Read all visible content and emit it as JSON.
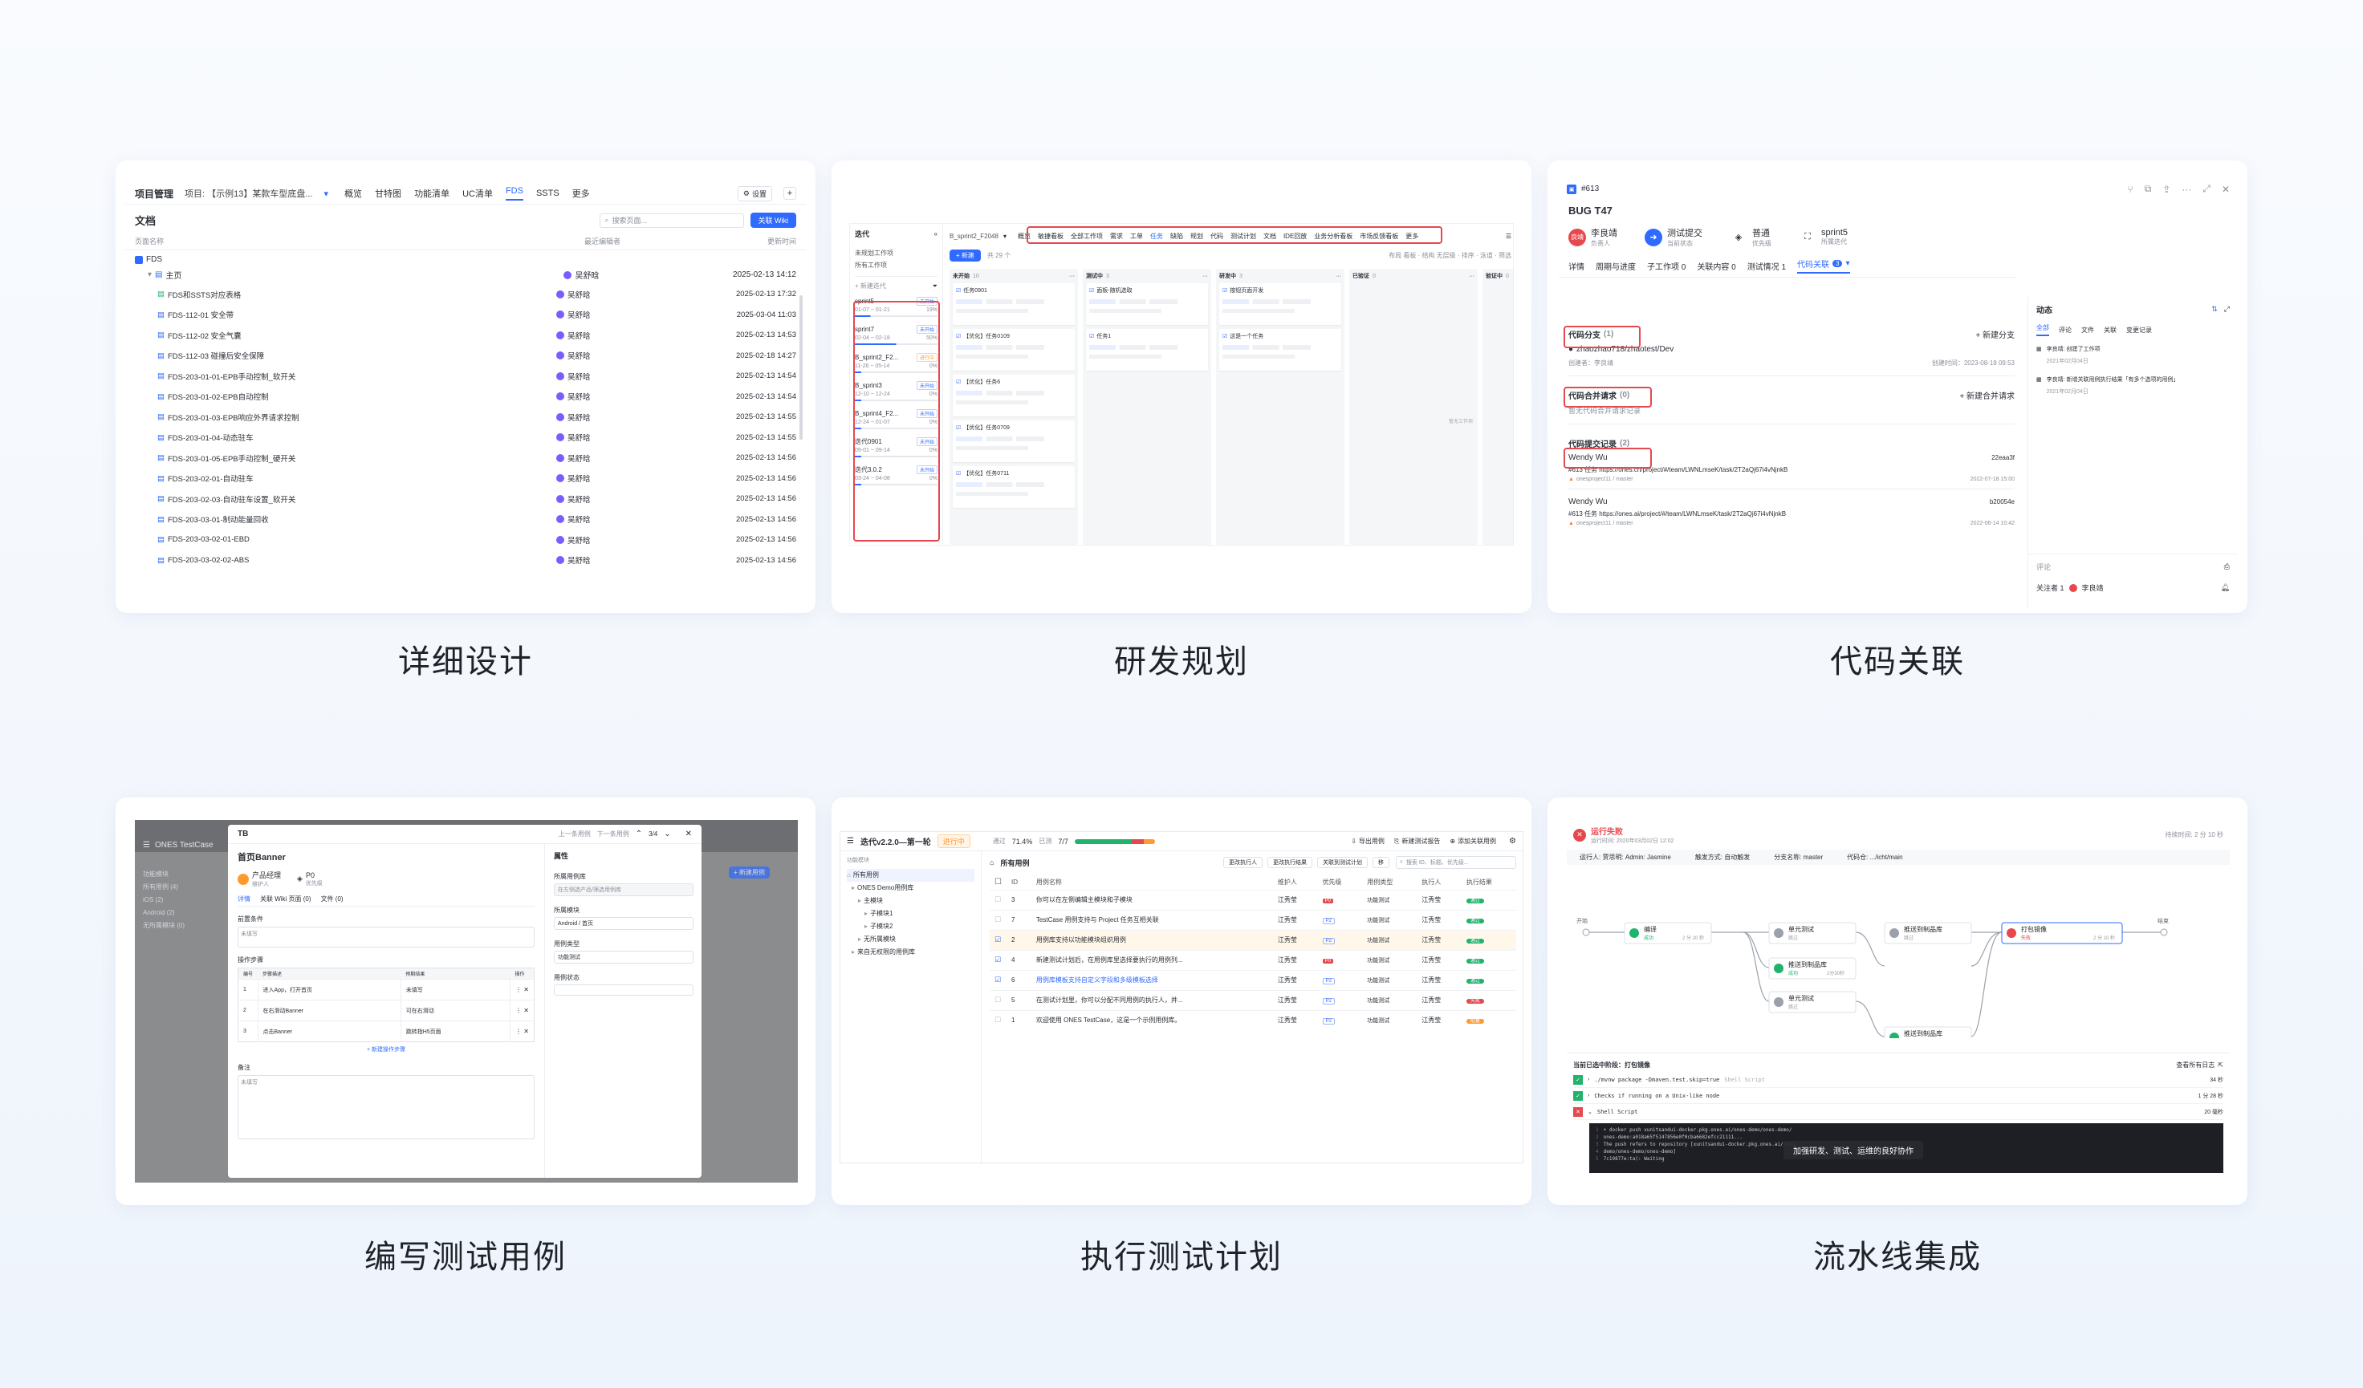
{
  "cards": {
    "c1": {
      "caption": "详细设计"
    },
    "c2": {
      "caption": "研发规划"
    },
    "c3": {
      "caption": "代码关联"
    },
    "c4": {
      "caption": "编写测试用例"
    },
    "c5": {
      "caption": "执行测试计划"
    },
    "c6": {
      "caption": "流水线集成"
    }
  },
  "design": {
    "app": "项目管理",
    "project": "项目: 【示例13】某款车型底盘...",
    "tabs": [
      "概览",
      "甘特图",
      "功能清单",
      "UC清单",
      "FDS",
      "SSTS",
      "更多"
    ],
    "settings": "设置",
    "doc_title": "文档",
    "search_placeholder": "搜索页面...",
    "wiki_btn": "关联 Wiki",
    "col_name": "页面名称",
    "col_editor": "最近编辑者",
    "col_time": "更新时间",
    "root": "FDS",
    "home": "主页",
    "rows": [
      {
        "name": "FDS和SSTS对应表格",
        "editor": "吴舒晗",
        "time": "2025-02-13 17:32"
      },
      {
        "name": "FDS-112-01 安全带",
        "editor": "吴舒晗",
        "time": "2025-03-04 11:03"
      },
      {
        "name": "FDS-112-02 安全气囊",
        "editor": "吴舒晗",
        "time": "2025-02-13 14:53"
      },
      {
        "name": "FDS-112-03 碰撞后安全保障",
        "editor": "吴舒晗",
        "time": "2025-02-18 14:27"
      },
      {
        "name": "FDS-203-01-01-EPB手动控制_软开关",
        "editor": "吴舒晗",
        "time": "2025-02-13 14:54"
      },
      {
        "name": "FDS-203-01-02-EPB自动控制",
        "editor": "吴舒晗",
        "time": "2025-02-13 14:54"
      },
      {
        "name": "FDS-203-01-03-EPB响应外界请求控制",
        "editor": "吴舒晗",
        "time": "2025-02-13 14:55"
      },
      {
        "name": "FDS-203-01-04-动态驻车",
        "editor": "吴舒晗",
        "time": "2025-02-13 14:55"
      },
      {
        "name": "FDS-203-01-05-EPB手动控制_硬开关",
        "editor": "吴舒晗",
        "time": "2025-02-13 14:56"
      },
      {
        "name": "FDS-203-02-01-自动驻车",
        "editor": "吴舒晗",
        "time": "2025-02-13 14:56"
      },
      {
        "name": "FDS-203-02-03-自动驻车设置_软开关",
        "editor": "吴舒晗",
        "time": "2025-02-13 14:56"
      },
      {
        "name": "FDS-203-03-01-制动能量回收",
        "editor": "吴舒晗",
        "time": "2025-02-13 14:56"
      },
      {
        "name": "FDS-203-03-02-01-EBD",
        "editor": "吴舒晗",
        "time": "2025-02-13 14:56"
      },
      {
        "name": "FDS-203-03-02-02-ABS",
        "editor": "吴舒晗",
        "time": "2025-02-13 14:56"
      }
    ],
    "home_editor": "吴舒晗",
    "home_time": "2025-02-13 14:12"
  },
  "plan": {
    "side_title": "迭代",
    "side_items": [
      "未规划工作项",
      "所有工作项"
    ],
    "new_sprint": "+ 新建迭代",
    "sprints": [
      {
        "name": "sprint5",
        "tag": "未开始",
        "date": "01-07 ~ 01-21",
        "pct": "19%"
      },
      {
        "name": "sprint7",
        "tag": "未开始",
        "date": "02-04 ~ 02-18",
        "pct": "50%"
      },
      {
        "name": "B_sprint2_F2...",
        "tag": "进行中",
        "date": "11-26 ~ 05-14",
        "pct": "0%"
      },
      {
        "name": "B_sprint3",
        "tag": "未开始",
        "date": "12-10 ~ 12-24",
        "pct": "0%"
      },
      {
        "name": "B_sprint4_F2...",
        "tag": "未开始",
        "date": "12-24 ~ 01-07",
        "pct": "0%"
      },
      {
        "name": "迭代0901",
        "tag": "未开始",
        "date": "09-01 ~ 09-14",
        "pct": "0%"
      },
      {
        "name": "迭代3.0.2",
        "tag": "未开始",
        "date": "03-24 ~ 04-08",
        "pct": "0%"
      }
    ],
    "crumb": "B_sprint2_F2048",
    "top_tabs": [
      "概览",
      "敏捷看板",
      "全部工作项",
      "需求",
      "工单",
      "任务",
      "缺陷",
      "规划",
      "代码",
      "测试计划",
      "文档",
      "IDE回放",
      "业务分析看板",
      "市场反馈看板",
      "更多"
    ],
    "new_item": "+ 新建",
    "count": "共 29 个",
    "columns": [
      {
        "title": "未开始",
        "count": "10"
      },
      {
        "title": "测试中",
        "count": "3"
      },
      {
        "title": "研发中",
        "count": "3"
      },
      {
        "title": "已验证",
        "count": "0"
      },
      {
        "title": "验证中",
        "count": "0"
      }
    ],
    "cards_a": [
      "任务0901",
      "【优化】任务0109",
      "【优化】任务6",
      "【优化】任务0709",
      "【优化】任务0711"
    ],
    "cards_b": [
      "面板-随机选取",
      "任务1"
    ],
    "cards_c": [
      "按钮页面开发",
      "这是一个任务"
    ],
    "empty": "暂无工作项"
  },
  "code": {
    "id": "#613",
    "title": "BUG T47",
    "owner": "李良靖",
    "owner_lbl": "负责人",
    "status": "测试提交",
    "status_lbl": "当前状态",
    "priority": "普通",
    "priority_lbl": "优先级",
    "sprint": "sprint5",
    "sprint_lbl": "所属迭代",
    "tabs": [
      "详情",
      "周期与进度",
      "子工作项 0",
      "关联内容 0",
      "测试情况 1",
      "代码关联"
    ],
    "code_badge": "3",
    "branch_title": "代码分支",
    "branch_count": "(1)",
    "new_branch": "+ 新建分支",
    "branch_name": "zhaozhao718/zhaotest/Dev",
    "branch_creator": "创建者：李良靖",
    "branch_time": "创建时间：2023-08-18 09:53",
    "merge_title": "代码合并请求",
    "merge_count": "(0)",
    "new_merge": "+ 新建合并请求",
    "merge_empty": "暂无代码合并请求记录",
    "commit_title": "代码提交记录",
    "commit_count": "(2)",
    "commits": [
      {
        "author": "Wendy Wu",
        "hash": "22eaa3f",
        "msg": "#613 任务 https://ones.cn/project/#/team/LWNLmseK/task/2T2aQj67i4vNjnkB",
        "repo": "onesproject11 / master",
        "time": "2022-07-18 15:00"
      },
      {
        "author": "Wendy Wu",
        "hash": "b20054e",
        "msg": "#613 任务 https://ones.ai/project/#/team/LWNLmseK/task/2T2aQj67i4vNjnkB",
        "repo": "onesproject11 / master",
        "time": "2022-06-14 10:42"
      }
    ],
    "activity_title": "动态",
    "activity_tabs": [
      "全部",
      "评论",
      "文件",
      "关联",
      "变更记录"
    ],
    "activity": [
      {
        "text": "李良靖: 创建了工作项",
        "time": "2021年02月04日"
      },
      {
        "text": "李良靖: 新增关联用例执行结果「有多个选项的用例」",
        "time": "2021年02月04日"
      }
    ],
    "comment_ph": "评论",
    "watchers": "关注者 1",
    "watcher": "李良靖"
  },
  "testcase": {
    "app": "ONES TestCase",
    "title": "TB",
    "prev": "上一条用例",
    "next": "下一条用例",
    "pager": "3/4",
    "name": "首页Banner",
    "role": "产品经理",
    "role_lbl": "维护人",
    "level": "P0",
    "level_lbl": "优先级",
    "tabs": [
      "详情",
      "关联 Wiki 页面 (0)",
      "文件 (0)"
    ],
    "precond_lbl": "前置条件",
    "precond_ph": "未填写",
    "steps_lbl": "操作步骤",
    "steps_cols": [
      "编号",
      "步骤描述",
      "预期结果",
      "操作"
    ],
    "steps": [
      {
        "no": "1",
        "desc": "进入App，打开首页",
        "exp": "未填写"
      },
      {
        "no": "2",
        "desc": "在右滑动Banner",
        "exp": "可在右滑动"
      },
      {
        "no": "3",
        "desc": "点击Banner",
        "exp": "跳转指H5页面"
      }
    ],
    "add_step": "+ 新建操作步骤",
    "note_lbl": "备注",
    "note_ph": "未填写",
    "attr_title": "属性",
    "attr_product": "所属用例库",
    "attr_product_ph": "在左侧选产品/筛选用例库",
    "attr_module": "所属模块",
    "attr_module_val": "Android / 首页",
    "attr_type": "用例类型",
    "attr_type_val": "功能测试",
    "attr_state": "用例状态",
    "bg_side": [
      "功能模块",
      "所有用例 (4)",
      "iOS (2)",
      "Android (2)",
      "无所属模块 (0)"
    ],
    "bg_btn": "+ 新建用例"
  },
  "exec": {
    "title": "迭代v2.2.0—第一轮",
    "status": "进行中",
    "pass_lbl": "通过",
    "pass": "71.4%",
    "done_lbl": "已测",
    "done": "7/7",
    "actions": [
      "导出用例",
      "新建测试报告",
      "添加关联用例"
    ],
    "tree_title": "功能模块",
    "tree": [
      "所有用例",
      "ONES Demo用例库",
      "主模块",
      "子模块1",
      "子模块2",
      "无所属模块",
      "来自无权限的用例库"
    ],
    "list_title": "所有用例",
    "list_btns": [
      "更改执行人",
      "更改执行结果",
      "关联到测试计划",
      "移"
    ],
    "search_ph": "搜索 ID、标题、优先级...",
    "cols": [
      "ID",
      "用例名称",
      "维护人",
      "优先级",
      "用例类型",
      "执行人",
      "执行结果"
    ],
    "rows": [
      {
        "id": "3",
        "name": "你可以在左侧编辑主模块和子模块",
        "owner": "江秀莹",
        "p": "P0",
        "type": "功能测试",
        "exec": "江秀莹",
        "res": "通过",
        "chk": false,
        "hl": false
      },
      {
        "id": "7",
        "name": "TestCase 用例支持与 Project 任务互相关联",
        "owner": "江秀莹",
        "p": "P2",
        "type": "功能测试",
        "exec": "江秀莹",
        "res": "通过",
        "chk": false,
        "hl": false
      },
      {
        "id": "2",
        "name": "用例库支持以功能模块组织用例",
        "owner": "江秀莹",
        "p": "P2",
        "type": "功能测试",
        "exec": "江秀莹",
        "res": "通过",
        "chk": true,
        "hl": true
      },
      {
        "id": "4",
        "name": "新建测试计划后，在用例库里选择要执行的用例列...",
        "owner": "江秀莹",
        "p": "P0",
        "type": "功能测试",
        "exec": "江秀莹",
        "res": "通过",
        "chk": true,
        "hl": false
      },
      {
        "id": "6",
        "name": "用例库模板支持自定义字段和多级模板选择",
        "owner": "江秀莹",
        "p": "P2",
        "type": "功能测试",
        "exec": "江秀莹",
        "res": "通过",
        "chk": true,
        "hl": false
      },
      {
        "id": "5",
        "name": "在测试计划里，你可以分配不同用例的执行人，并...",
        "owner": "江秀莹",
        "p": "P2",
        "type": "功能测试",
        "exec": "江秀莹",
        "res": "失败",
        "chk": false,
        "hl": false
      },
      {
        "id": "1",
        "name": "欢迎使用 ONES TestCase，这是一个示例用例库。",
        "owner": "江秀莹",
        "p": "P2",
        "type": "功能测试",
        "exec": "江秀莹",
        "res": "阻塞",
        "chk": false,
        "hl": false
      }
    ]
  },
  "pipeline": {
    "status": "运行失败",
    "run_time": "运行时间: 2020年03月02日 12:02",
    "duration": "持续时间: 2 分 10 秒",
    "runner": "运行人: 贾思明: Admin: Jasmine",
    "trigger": "触发方式: 自动触发",
    "branch": "分支名称: master",
    "repo": "代码仓: .../icht/main",
    "start": "开始",
    "end": "结束",
    "stages": [
      {
        "name": "编译",
        "sub": "成功",
        "t": "2 分 20 秒"
      },
      {
        "name": "单元测试",
        "sub": "跳过",
        "t": ""
      },
      {
        "name": "推送到制品库",
        "sub": "成功",
        "t": "2分30秒"
      },
      {
        "name": "单元测试",
        "sub": "跳过",
        "t": ""
      },
      {
        "name": "推送到制品库",
        "sub": "成功",
        "t": "2分30秒"
      },
      {
        "name": "推送到制品库",
        "sub": "跳过",
        "t": ""
      },
      {
        "name": "打包镜像",
        "sub": "失败",
        "t": "2 分 10 秒"
      }
    ],
    "stage_title": "当前已选中阶段：打包镜像",
    "view_all": "查看所有日志",
    "logs": [
      {
        "text": "./mvnw package -Dmaven.test.skip=true",
        "hint": "Shell Script",
        "t": "34 秒",
        "ok": true
      },
      {
        "text": "Checks if running on a Unix-like node",
        "hint": "",
        "t": "1 分 28 秒",
        "ok": true
      },
      {
        "text": "Shell Script",
        "hint": "",
        "t": "20 毫秒",
        "ok": false
      }
    ],
    "console": [
      "+ docker push xunitsandui-docker.pkg.ones.ai/ones-demo/ones-demo/",
      "ones-demo:a018a65f5147856e0f0cba6682efcc21111...",
      "The push refers to repository [xunitsandui-docker.pkg.ones.ai/ones-",
      "demo/ones-demo/ones-demo]",
      "7c19877e:ta(: Waiting"
    ],
    "toast": "加强研发、测试、运维的良好协作"
  },
  "colors": {
    "accent": "#2f6bff",
    "red": "#e5484d",
    "green": "#21b36b",
    "orange": "#ff9a2e"
  }
}
